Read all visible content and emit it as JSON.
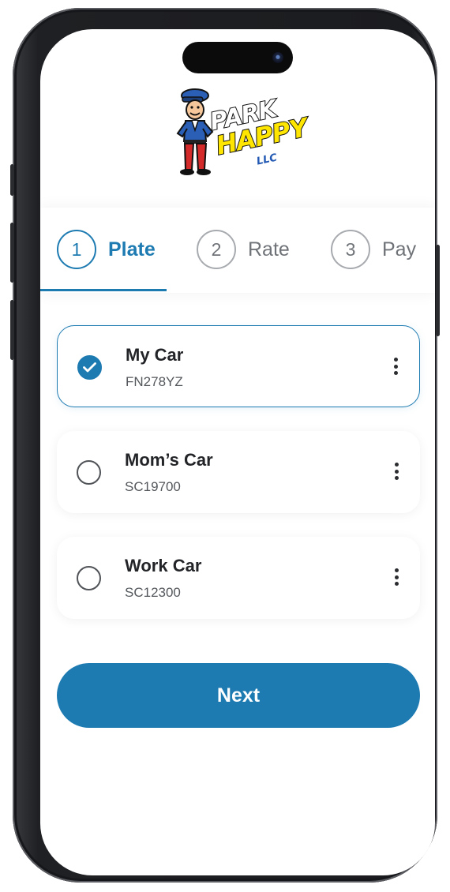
{
  "brand": {
    "line1": "PARK",
    "line2": "HAPPY",
    "line3": "LLC"
  },
  "stepper": {
    "steps": [
      {
        "number": "1",
        "label": "Plate",
        "active": true
      },
      {
        "number": "2",
        "label": "Rate",
        "active": false
      },
      {
        "number": "3",
        "label": "Pay",
        "active": false
      }
    ]
  },
  "cars": [
    {
      "name": "My Car",
      "plate": "FN278YZ",
      "selected": true
    },
    {
      "name": "Mom’s Car",
      "plate": "SC19700",
      "selected": false
    },
    {
      "name": "Work Car",
      "plate": "SC12300",
      "selected": false
    }
  ],
  "next_button": {
    "label": "Next"
  },
  "colors": {
    "accent": "#1d7bb2",
    "inactive": "#6f7378",
    "text": "#222427"
  },
  "icons": {
    "selected_radio": "checkmark-icon",
    "more_menu": "more-vertical-icon"
  }
}
